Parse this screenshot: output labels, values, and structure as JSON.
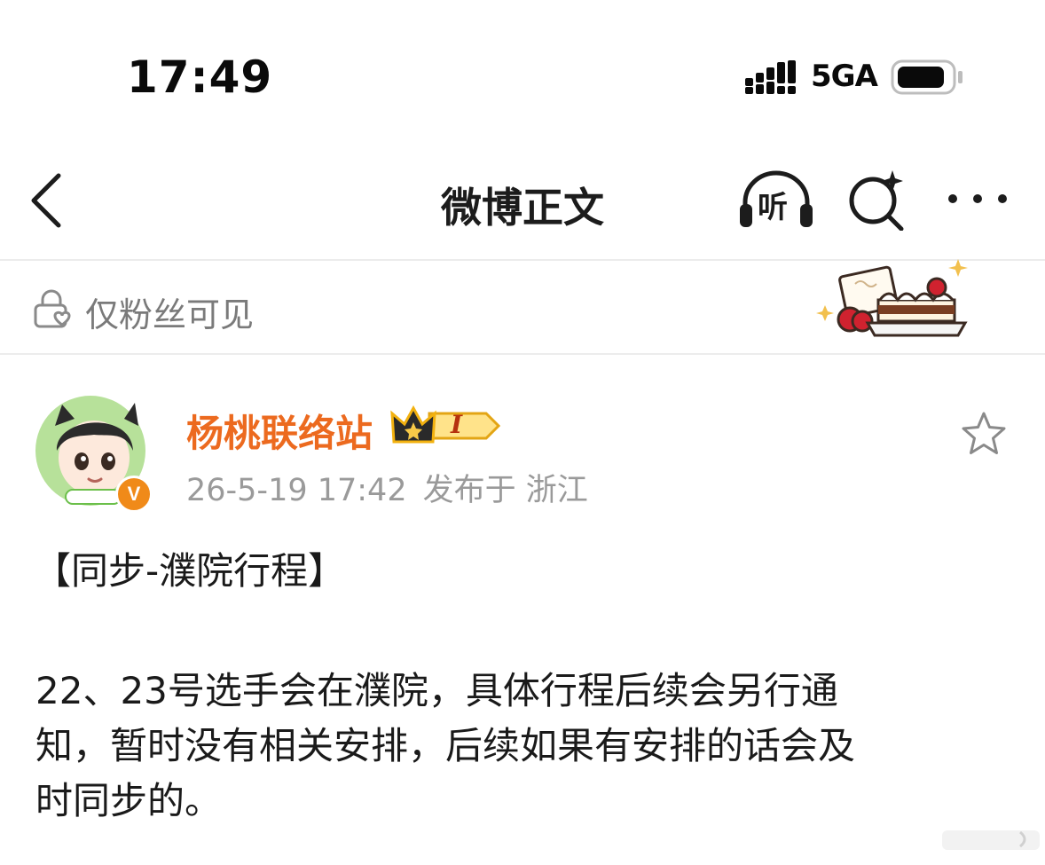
{
  "status_bar": {
    "time": "17:49",
    "network": "5GA",
    "signal_icon": "signal-bars-icon",
    "battery_icon": "battery-icon"
  },
  "nav": {
    "title": "微博正文",
    "back_icon": "chevron-left-icon",
    "listen_label": "听",
    "listen_icon": "headphones-icon",
    "search_icon": "sparkle-search-icon",
    "more_icon": "more-dots-icon"
  },
  "visibility": {
    "text": "仅粉丝可见",
    "icon": "lock-heart-icon",
    "decoration": "cake-sticker"
  },
  "author": {
    "name": "杨桃联络站",
    "badge_text": "I",
    "badge_icon": "crown-badge-icon",
    "verified_label": "V",
    "timestamp": "26-5-19 17:42",
    "location": "发布于 浙江"
  },
  "post": {
    "title": "【同步-濮院行程】",
    "body_lines": [
      "22、23号选手会在濮院，具体行程后续会另行通",
      "知，暂时没有相关安排，后续如果有安排的话会及",
      "时同步的。"
    ]
  },
  "colors": {
    "author_name": "#ec6a1f",
    "badge_gold": "#f7c948",
    "verified": "#f08a19"
  }
}
